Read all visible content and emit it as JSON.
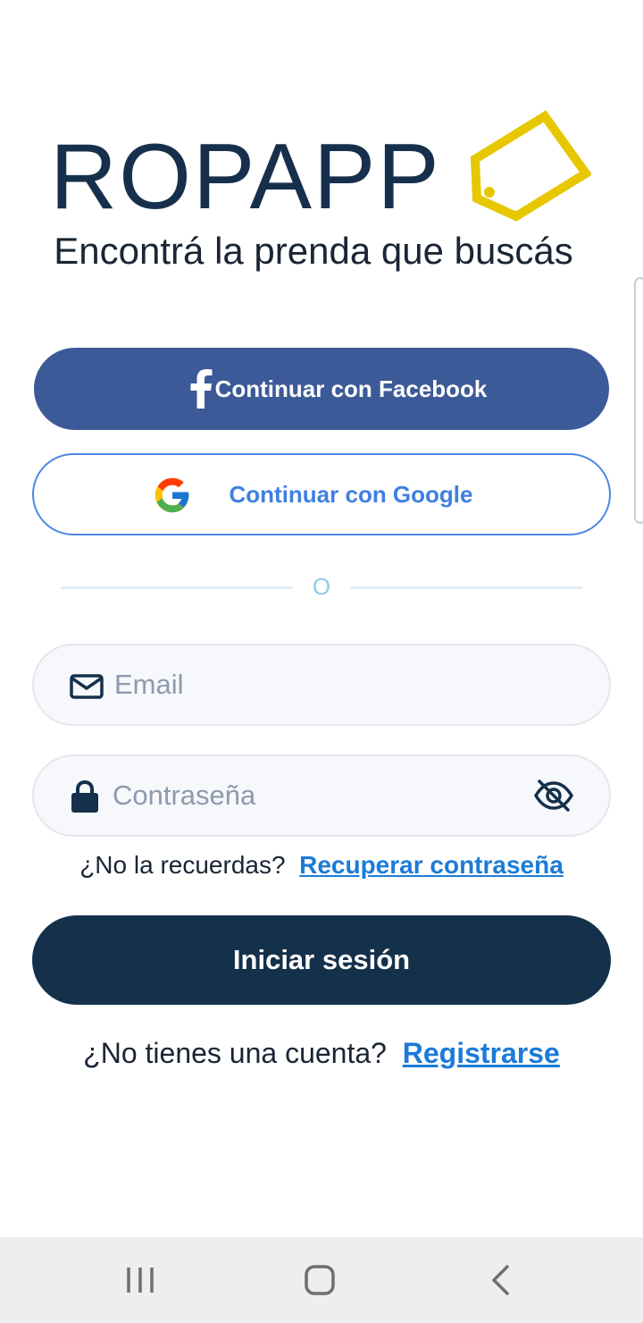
{
  "brand": {
    "name": "ROPAPP",
    "tagline": "Encontrá la prenda que buscás",
    "logo_icon": "price-tag-icon",
    "colors": {
      "navy": "#16304c",
      "tag_yellow": "#e6c700"
    }
  },
  "social": {
    "facebook_label": "Continuar con Facebook",
    "facebook_icon": "facebook-icon",
    "google_label": "Continuar con Google",
    "google_icon": "google-icon",
    "colors": {
      "facebook": "#3d5a98",
      "google_text": "#3f7fe0"
    }
  },
  "divider": {
    "label": "O"
  },
  "form": {
    "email": {
      "placeholder": "Email",
      "value": "",
      "icon": "envelope-icon"
    },
    "password": {
      "placeholder": "Contraseña",
      "value": "",
      "icon": "lock-icon",
      "toggle_icon": "eye-off-icon"
    }
  },
  "recover": {
    "prompt": "¿No la recuerdas?",
    "link": "Recuperar contraseña"
  },
  "login": {
    "label": "Iniciar sesión",
    "color": "#15304b"
  },
  "register": {
    "prompt": "¿No tienes una cuenta?",
    "link": "Registrarse",
    "link_color": "#1c7bd8"
  },
  "system_nav": {
    "recents_icon": "recents-icon",
    "home_icon": "home-icon",
    "back_icon": "back-icon"
  }
}
